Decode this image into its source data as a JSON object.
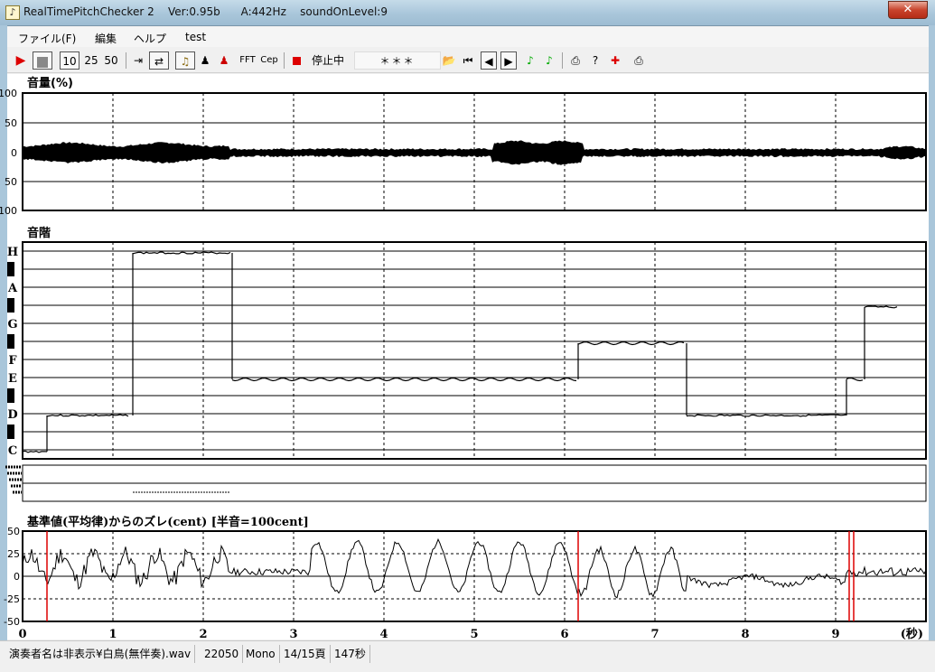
{
  "window": {
    "title": "RealTimePitchChecker 2    Ver:0.95b      A:442Hz    soundOnLevel:9",
    "close_label": "✕"
  },
  "menu": [
    "ファイル(F)",
    "編集",
    "ヘルプ",
    "test"
  ],
  "toolbar": {
    "play_icon": "play-icon",
    "stop_icon": "stop-icon",
    "speed_10": "10",
    "speed_25": "25",
    "speed_50": "50",
    "fft_label": "FFT",
    "cep_label": "Cep",
    "status_label": "停止中",
    "stars": "＊＊＊"
  },
  "volume_panel": {
    "title": "音量(%)",
    "y_ticks": [
      "100",
      "50",
      "0",
      "50",
      "100"
    ]
  },
  "scale_panel": {
    "title": "音階",
    "notes": [
      "H",
      "A",
      "G",
      "F",
      "E",
      "D",
      "C"
    ]
  },
  "cent_panel": {
    "title": "基準値(平均律)からのズレ(cent) [半音=100cent]",
    "y_ticks": [
      "50",
      "25",
      "0",
      "-25",
      "-50"
    ]
  },
  "time_axis": {
    "ticks": [
      "0",
      "1",
      "2",
      "3",
      "4",
      "5",
      "6",
      "7",
      "8",
      "9"
    ],
    "unit_label": "(秒)"
  },
  "status_bar": {
    "file": "演奏者名は非表示¥白鳥(無伴奏).wav",
    "rate": "22050",
    "channel": "Mono",
    "page": "14/15頁",
    "length": "147秒"
  },
  "chart_data": {
    "type": "line",
    "x_label": "(秒)",
    "xlim": [
      0,
      10
    ],
    "pitch_segments": [
      {
        "note": "C",
        "t_start": 0.0,
        "t_end": 0.27
      },
      {
        "note": "D",
        "t_start": 0.27,
        "t_end": 1.2
      },
      {
        "note": "H",
        "t_start": 1.22,
        "t_end": 2.3
      },
      {
        "note": "E",
        "t_start": 2.32,
        "t_end": 6.15
      },
      {
        "note": "F#",
        "t_start": 6.15,
        "t_end": 7.35
      },
      {
        "note": "D",
        "t_start": 7.35,
        "t_end": 9.12
      },
      {
        "note": "E",
        "t_start": 9.12,
        "t_end": 9.3
      },
      {
        "note": "G#",
        "t_start": 9.32,
        "t_end": 9.7
      }
    ],
    "cent_ylim": [
      -50,
      50
    ],
    "volume_ylim": [
      -100,
      100
    ]
  }
}
